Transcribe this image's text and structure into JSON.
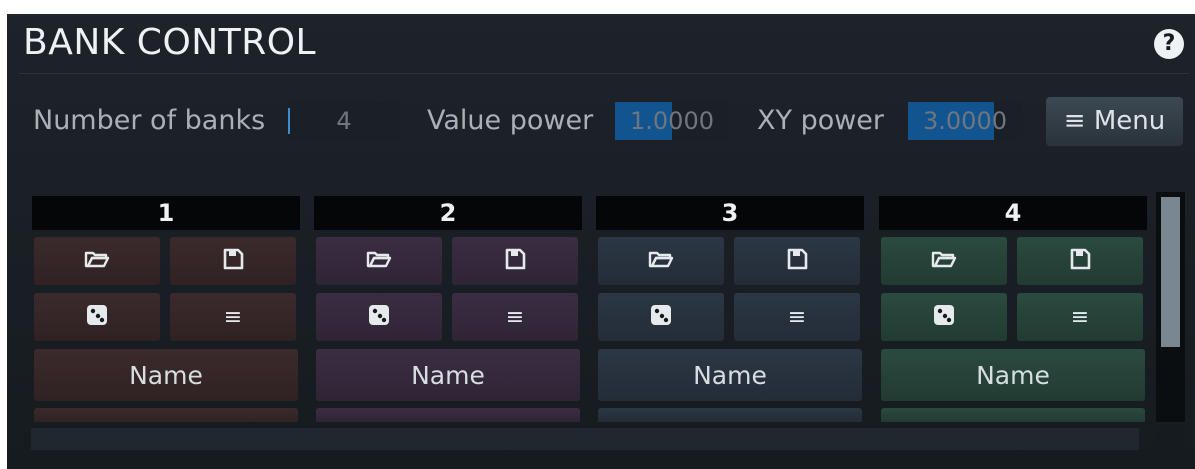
{
  "panel": {
    "title": "BANK CONTROL",
    "help_label": "?"
  },
  "params": {
    "banks_label": "Number of banks",
    "banks_value": "4",
    "value_power_label": "Value power",
    "value_power": "1.0000",
    "value_power_fill": 0.5,
    "xy_power_label": "XY power",
    "xy_power": "3.0000",
    "xy_power_fill": 0.75,
    "menu_label": "≡ Menu"
  },
  "banks": [
    {
      "number": "1",
      "name_label": "Name",
      "color": "#3b2a2c"
    },
    {
      "number": "2",
      "name_label": "Name",
      "color": "#3b2d43"
    },
    {
      "number": "3",
      "name_label": "Name",
      "color": "#2c3745"
    },
    {
      "number": "4",
      "name_label": "Name",
      "color": "#2b4a3f"
    }
  ],
  "icons": {
    "open": "folder-open-icon",
    "save": "floppy-disk-icon",
    "random": "dice-icon",
    "menu": "≡"
  }
}
